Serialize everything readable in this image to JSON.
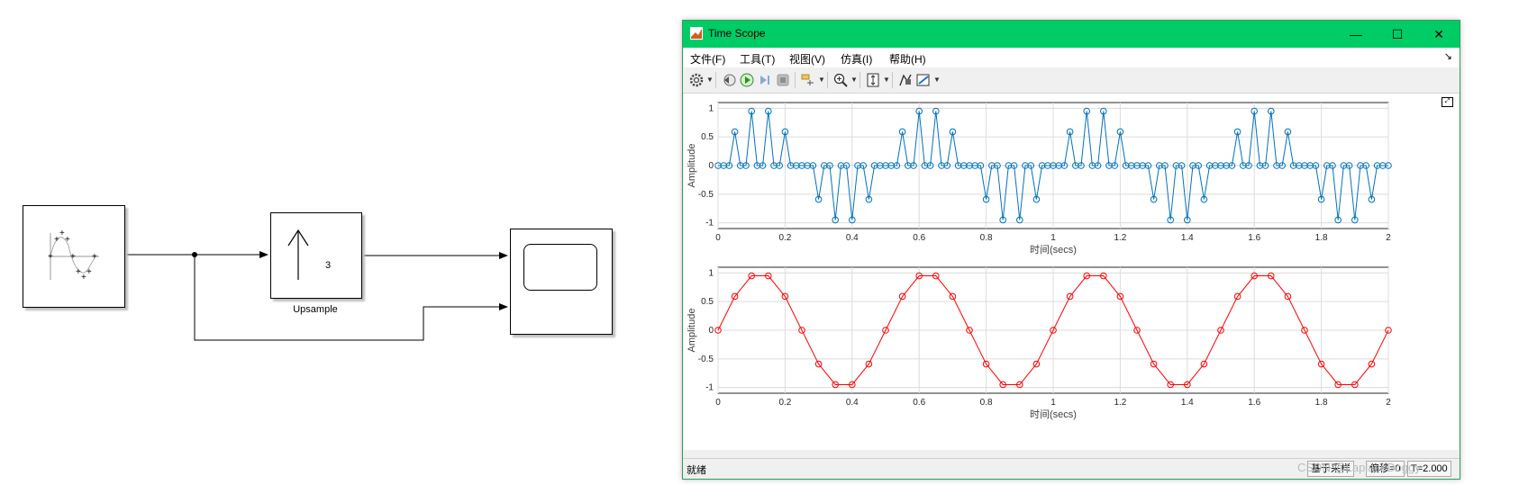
{
  "model": {
    "upsample_label": "Upsample",
    "upsample_factor": "3"
  },
  "window": {
    "title": "Time Scope",
    "controls": {
      "minimize": "—",
      "maximize": "☐",
      "close": "✕"
    },
    "menu": [
      "文件(F)",
      "工具(T)",
      "视图(V)",
      "仿真(I)",
      "帮助(H)"
    ],
    "toolbar_icons": [
      "gear-icon",
      "step-back-icon",
      "run-icon",
      "step-forward-icon",
      "stop-icon",
      "highlight-icon",
      "zoom-in-icon",
      "scale-axes-icon",
      "data-cursor-icon",
      "measurements-icon"
    ],
    "status": {
      "ready": "就绪",
      "sample_based": "基于采样",
      "offset": "偏移=0",
      "time": "T=2.000"
    }
  },
  "colors": {
    "titlebar": "#00cc66",
    "series1": "#0072bd",
    "series2": "#ff0000"
  },
  "chart_data": [
    {
      "type": "line",
      "marker": "circle",
      "ylabel": "Amplitude",
      "xlabel": "时间(secs)",
      "xlim": [
        0,
        2
      ],
      "ylim": [
        -1.1,
        1.1
      ],
      "xticks": [
        "0",
        "0.2",
        "0.4",
        "0.6",
        "0.8",
        "1",
        "1.2",
        "1.4",
        "1.6",
        "1.8",
        "2"
      ],
      "yticks": [
        "1",
        "0.5",
        "0",
        "-0.5",
        "-1"
      ],
      "grid": true,
      "series": [
        {
          "color": "#0072bd",
          "x": [
            0,
            0.0167,
            0.0333,
            0.05,
            0.0667,
            0.0833,
            0.1,
            0.1167,
            0.1333,
            0.15,
            0.1667,
            0.1833,
            0.2,
            0.2167,
            0.2333,
            0.25,
            0.2667,
            0.2833,
            0.3,
            0.3167,
            0.3333,
            0.35,
            0.3667,
            0.3833,
            0.4,
            0.4167,
            0.4333,
            0.45,
            0.4667,
            0.4833,
            0.5,
            0.5167,
            0.5333,
            0.55,
            0.5667,
            0.5833,
            0.6,
            0.6167,
            0.6333,
            0.65,
            0.6667,
            0.6833,
            0.7,
            0.7167,
            0.7333,
            0.75,
            0.7667,
            0.7833,
            0.8,
            0.8167,
            0.8333,
            0.85,
            0.8667,
            0.8833,
            0.9,
            0.9167,
            0.9333,
            0.95,
            0.9667,
            0.9833,
            1,
            1.0167,
            1.0333,
            1.05,
            1.0667,
            1.0833,
            1.1,
            1.1167,
            1.1333,
            1.15,
            1.1667,
            1.1833,
            1.2,
            1.2167,
            1.2333,
            1.25,
            1.2667,
            1.2833,
            1.3,
            1.3167,
            1.3333,
            1.35,
            1.3667,
            1.3833,
            1.4,
            1.4167,
            1.4333,
            1.45,
            1.4667,
            1.4833,
            1.5,
            1.5167,
            1.5333,
            1.55,
            1.5667,
            1.5833,
            1.6,
            1.6167,
            1.6333,
            1.65,
            1.6667,
            1.6833,
            1.7,
            1.7167,
            1.7333,
            1.75,
            1.7667,
            1.7833,
            1.8,
            1.8167,
            1.8333,
            1.85,
            1.8667,
            1.8833,
            1.9,
            1.9167,
            1.9333,
            1.95,
            1.9667,
            1.9833,
            2
          ],
          "y": [
            0,
            0,
            0,
            0.59,
            0,
            0,
            0.95,
            0,
            0,
            0.95,
            0,
            0,
            0.59,
            0,
            0,
            0,
            0,
            0,
            -0.59,
            0,
            0,
            -0.95,
            0,
            0,
            -0.95,
            0,
            0,
            -0.59,
            0,
            0,
            0,
            0,
            0,
            0.59,
            0,
            0,
            0.95,
            0,
            0,
            0.95,
            0,
            0,
            0.59,
            0,
            0,
            0,
            0,
            0,
            -0.59,
            0,
            0,
            -0.95,
            0,
            0,
            -0.95,
            0,
            0,
            -0.59,
            0,
            0,
            0,
            0,
            0,
            0.59,
            0,
            0,
            0.95,
            0,
            0,
            0.95,
            0,
            0,
            0.59,
            0,
            0,
            0,
            0,
            0,
            -0.59,
            0,
            0,
            -0.95,
            0,
            0,
            -0.95,
            0,
            0,
            -0.59,
            0,
            0,
            0,
            0,
            0,
            0.59,
            0,
            0,
            0.95,
            0,
            0,
            0.95,
            0,
            0,
            0.59,
            0,
            0,
            0,
            0,
            0,
            -0.59,
            0,
            0,
            -0.95,
            0,
            0,
            -0.95,
            0,
            0,
            -0.59,
            0,
            0,
            0
          ]
        }
      ]
    },
    {
      "type": "line",
      "marker": "circle",
      "ylabel": "Amplitude",
      "xlabel": "时间(secs)",
      "xlim": [
        0,
        2
      ],
      "ylim": [
        -1.1,
        1.1
      ],
      "xticks": [
        "0",
        "0.2",
        "0.4",
        "0.6",
        "0.8",
        "1",
        "1.2",
        "1.4",
        "1.6",
        "1.8",
        "2"
      ],
      "yticks": [
        "1",
        "0.5",
        "0",
        "-0.5",
        "-1"
      ],
      "grid": true,
      "series": [
        {
          "color": "#ff0000",
          "x": [
            0,
            0.05,
            0.1,
            0.15,
            0.2,
            0.25,
            0.3,
            0.35,
            0.4,
            0.45,
            0.5,
            0.55,
            0.6,
            0.65,
            0.7,
            0.75,
            0.8,
            0.85,
            0.9,
            0.95,
            1,
            1.05,
            1.1,
            1.15,
            1.2,
            1.25,
            1.3,
            1.35,
            1.4,
            1.45,
            1.5,
            1.55,
            1.6,
            1.65,
            1.7,
            1.75,
            1.8,
            1.85,
            1.9,
            1.95,
            2
          ],
          "y": [
            0,
            0.59,
            0.95,
            0.95,
            0.59,
            0,
            -0.59,
            -0.95,
            -0.95,
            -0.59,
            0,
            0.59,
            0.95,
            0.95,
            0.59,
            0,
            -0.59,
            -0.95,
            -0.95,
            -0.59,
            0,
            0.59,
            0.95,
            0.95,
            0.59,
            0,
            -0.59,
            -0.95,
            -0.95,
            -0.59,
            0,
            0.59,
            0.95,
            0.95,
            0.59,
            0,
            -0.59,
            -0.95,
            -0.95,
            -0.59,
            0
          ]
        }
      ]
    }
  ],
  "watermark": "CSDN @LaplaceDoggy"
}
